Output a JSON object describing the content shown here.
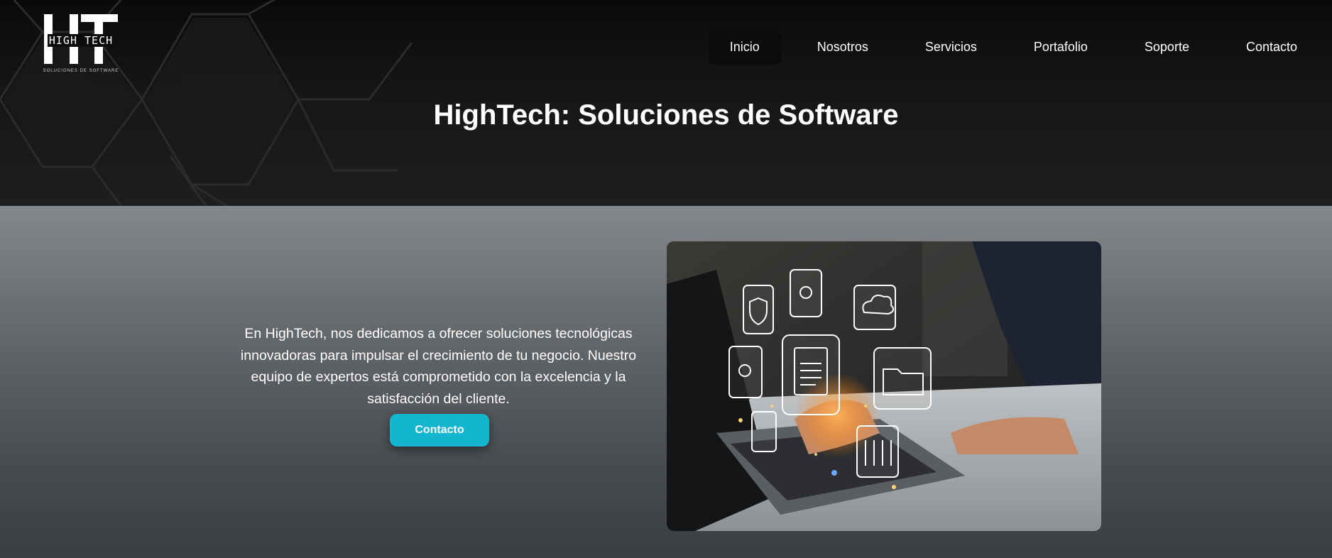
{
  "logo": {
    "title": "HIGH TECH",
    "subtitle": "SOLUCIONES DE SOFTWARE"
  },
  "nav": {
    "items": [
      {
        "label": "Inicio",
        "active": true
      },
      {
        "label": "Nosotros",
        "active": false
      },
      {
        "label": "Servicios",
        "active": false
      },
      {
        "label": "Portafolio",
        "active": false
      },
      {
        "label": "Soporte",
        "active": false
      },
      {
        "label": "Contacto",
        "active": false
      }
    ]
  },
  "hero": {
    "title": "HighTech: Soluciones de Software"
  },
  "main": {
    "intro": "En HighTech, nos dedicamos a ofrecer soluciones tecnológicas innovadoras para impulsar el crecimiento de tu negocio. Nuestro equipo de expertos está comprometido con la excelencia y la satisfacción del cliente.",
    "cta_label": "Contacto",
    "photo_icons": [
      "lock-shield-icon",
      "gears-icon",
      "cloud-download-icon",
      "search-file-icon",
      "document-icon",
      "folder-icon",
      "user-icon",
      "binders-icon"
    ]
  },
  "colors": {
    "header_bg": "#121212",
    "cta": "#14b6cf",
    "main_top": "#85888b",
    "main_bottom": "#3a3d41"
  }
}
